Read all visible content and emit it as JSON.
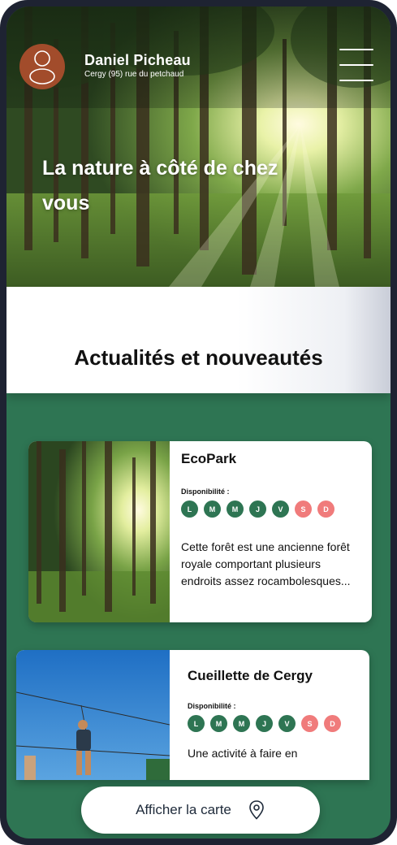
{
  "header": {
    "user_name": "Daniel Picheau",
    "user_address": "Cergy (95) rue du petchaud",
    "avatar_icon": "user-avatar-icon",
    "menu_icon": "hamburger-menu-icon"
  },
  "hero": {
    "title": "La nature à côté de chez vous"
  },
  "news": {
    "title": "Actualités et nouveautés"
  },
  "cards": [
    {
      "title": "EcoPark",
      "availability_label": "Disponibilité :",
      "days": [
        {
          "letter": "L",
          "open": true
        },
        {
          "letter": "M",
          "open": true
        },
        {
          "letter": "M",
          "open": true
        },
        {
          "letter": "J",
          "open": true
        },
        {
          "letter": "V",
          "open": true
        },
        {
          "letter": "S",
          "open": false
        },
        {
          "letter": "D",
          "open": false
        }
      ],
      "description": "Cette forêt est une ancienne forêt royale comportant plusieurs endroits assez rocambolesques..."
    },
    {
      "title": "Cueillette de Cergy",
      "availability_label": "Disponibilité :",
      "days": [
        {
          "letter": "L",
          "open": true
        },
        {
          "letter": "M",
          "open": true
        },
        {
          "letter": "M",
          "open": true
        },
        {
          "letter": "J",
          "open": true
        },
        {
          "letter": "V",
          "open": true
        },
        {
          "letter": "S",
          "open": false
        },
        {
          "letter": "D",
          "open": false
        }
      ],
      "description": "Une activité à faire en"
    }
  ],
  "map_button": {
    "label": "Afficher la carte",
    "icon": "map-pin-icon"
  },
  "colors": {
    "primary_green": "#2e7553",
    "closed_red": "#f07b7b",
    "avatar_brown": "#a24c2b",
    "device_frame": "#1e2332"
  }
}
